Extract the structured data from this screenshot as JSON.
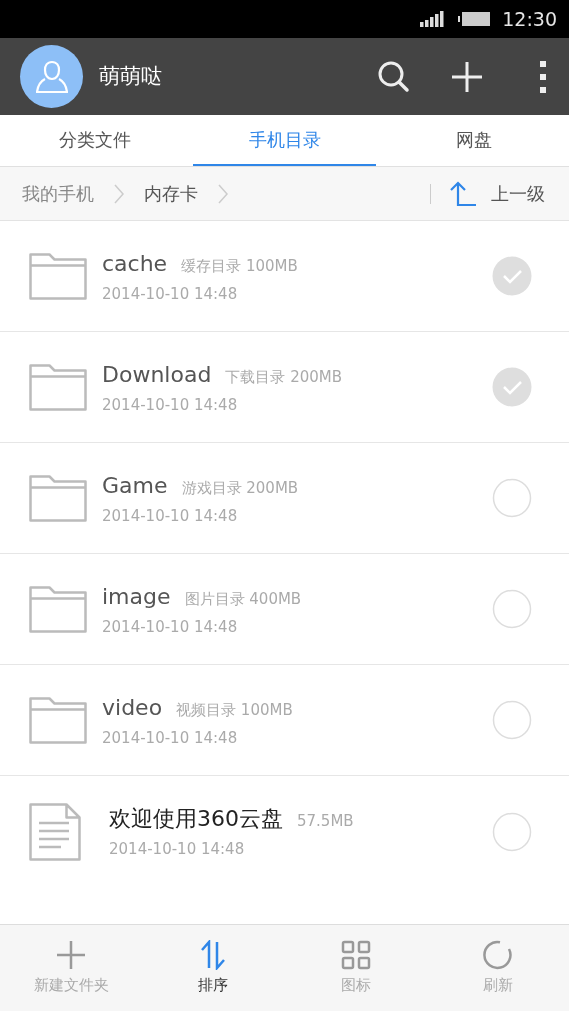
{
  "status_bar": {
    "time": "12:30"
  },
  "header": {
    "username": "萌萌哒"
  },
  "tabs": [
    {
      "label": "分类文件",
      "selected": false
    },
    {
      "label": "手机目录",
      "selected": true
    },
    {
      "label": "网盘",
      "selected": false
    }
  ],
  "breadcrumb": {
    "items": [
      "我的手机",
      "内存卡"
    ],
    "up_label": "上一级"
  },
  "files": [
    {
      "kind": "folder",
      "name": "cache",
      "info": "缓存目录 100MB",
      "date": "2014-10-10 14:48",
      "checked": true
    },
    {
      "kind": "folder",
      "name": "Download",
      "info": "下载目录 200MB",
      "date": "2014-10-10 14:48",
      "checked": true
    },
    {
      "kind": "folder",
      "name": "Game",
      "info": "游戏目录 200MB",
      "date": "2014-10-10 14:48",
      "checked": false
    },
    {
      "kind": "folder",
      "name": "image",
      "info": "图片目录 400MB",
      "date": "2014-10-10 14:48",
      "checked": false
    },
    {
      "kind": "folder",
      "name": "video",
      "info": "视频目录 100MB",
      "date": "2014-10-10 14:48",
      "checked": false
    },
    {
      "kind": "file",
      "name": "欢迎使用360云盘",
      "info": "57.5MB",
      "date": "2014-10-10 14:48",
      "checked": false
    }
  ],
  "toolbar": [
    {
      "kind": "new-folder",
      "label": "新建文件夹",
      "selected": false
    },
    {
      "kind": "sort",
      "label": "排序",
      "selected": true
    },
    {
      "kind": "grid",
      "label": "图标",
      "selected": false
    },
    {
      "kind": "refresh",
      "label": "刷新",
      "selected": false
    }
  ]
}
